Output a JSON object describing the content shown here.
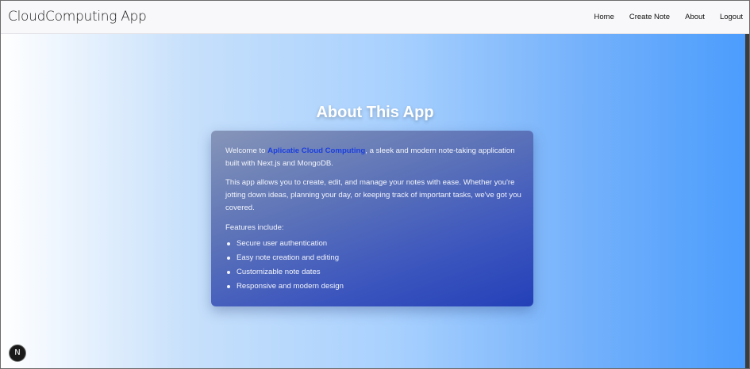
{
  "header": {
    "brand": "CloudComputing App",
    "nav": [
      {
        "label": "Home"
      },
      {
        "label": "Create Note"
      },
      {
        "label": "About"
      },
      {
        "label": "Logout"
      }
    ]
  },
  "main": {
    "title": "About This App",
    "card": {
      "welcome_prefix": "Welcome to ",
      "app_link": "Aplicatie Cloud Computing",
      "welcome_suffix": ", a sleek and modern note-taking application built with Next.js and MongoDB.",
      "description": "This app allows you to create, edit, and manage your notes with ease. Whether you're jotting down ideas, planning your day, or keeping track of important tasks, we've got you covered.",
      "features_heading": "Features include:",
      "features": [
        "Secure user authentication",
        "Easy note creation and editing",
        "Customizable note dates",
        "Responsive and modern design"
      ]
    }
  },
  "dev_badge": {
    "label": "N",
    "icon": "nextjs-icon"
  },
  "colors": {
    "link": "#1b3fe0",
    "gradient_start": "#ffffff",
    "gradient_end": "#4a9cfd",
    "card_start": "#8695b8",
    "card_end": "#2440b8"
  }
}
